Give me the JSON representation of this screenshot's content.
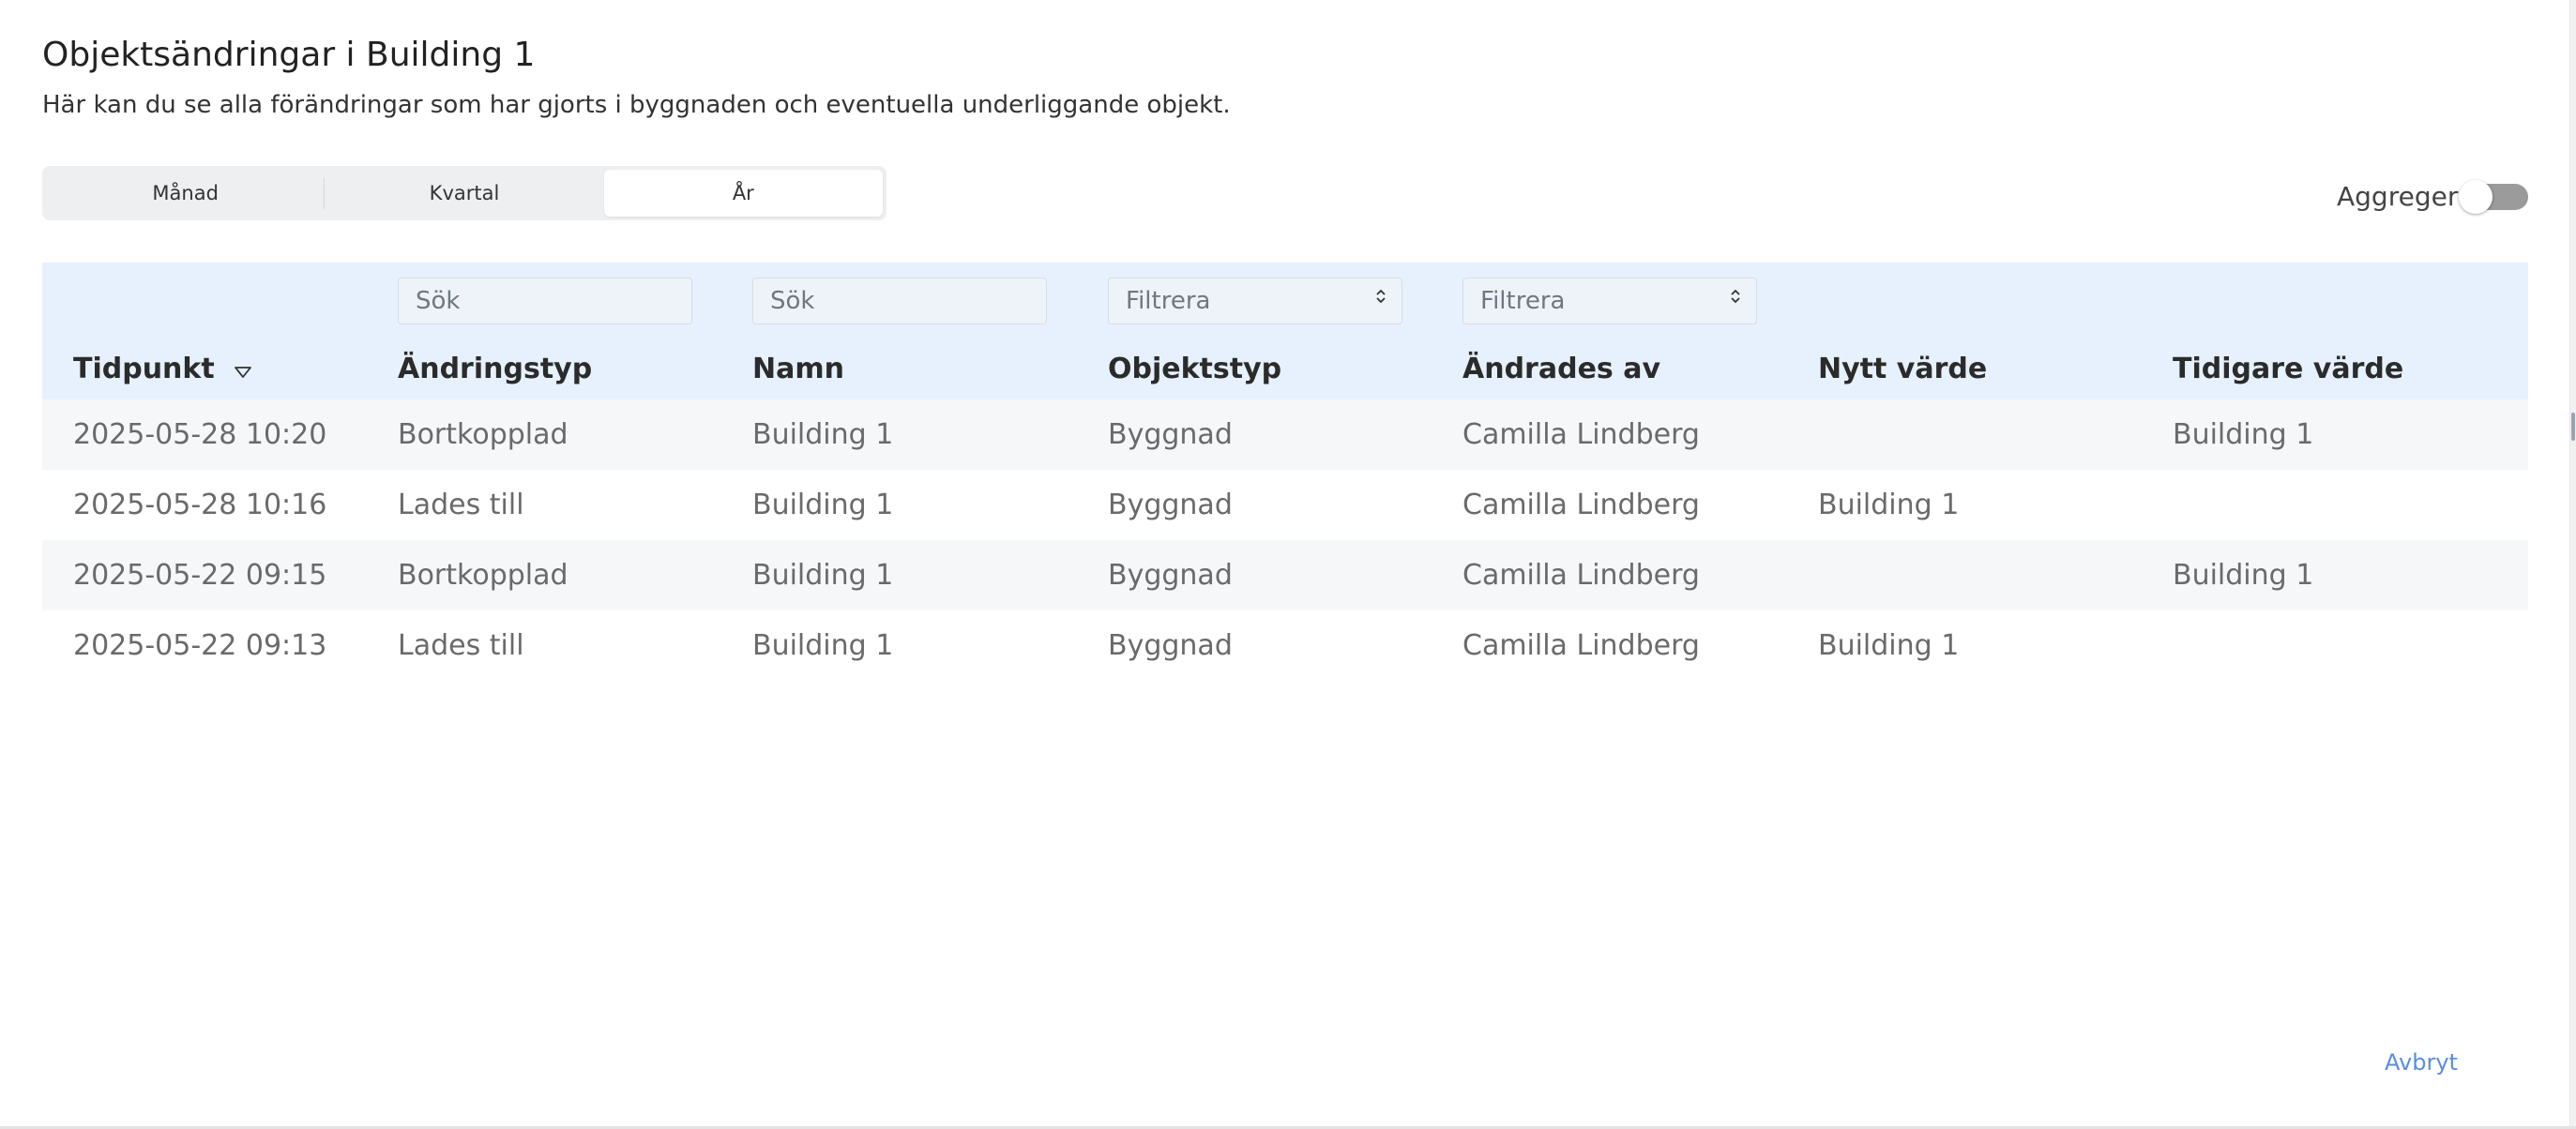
{
  "dialog": {
    "title": "Objektsändringar i Building 1",
    "subtitle": "Här kan du se alla förändringar som har gjorts i byggnaden och eventuella underliggande objekt."
  },
  "period_tabs": [
    {
      "label": "Månad",
      "active": false
    },
    {
      "label": "Kvartal",
      "active": false
    },
    {
      "label": "År",
      "active": true
    }
  ],
  "aggregate": {
    "label": "Aggregera",
    "enabled": false
  },
  "filters": {
    "change_type_placeholder": "Sök",
    "name_placeholder": "Sök",
    "object_type_placeholder": "Filtrera",
    "changed_by_placeholder": "Filtrera"
  },
  "columns": [
    "Tidpunkt",
    "Ändringstyp",
    "Namn",
    "Objektstyp",
    "Ändrades av",
    "Nytt värde",
    "Tidigare värde"
  ],
  "rows": [
    [
      "2025-05-28 10:20",
      "Bortkopplad",
      "Building 1",
      "Byggnad",
      "Camilla Lindberg",
      "",
      "Building 1"
    ],
    [
      "2025-05-28 10:16",
      "Lades till",
      "Building 1",
      "Byggnad",
      "Camilla Lindberg",
      "Building 1",
      ""
    ],
    [
      "2025-05-22 09:15",
      "Bortkopplad",
      "Building 1",
      "Byggnad",
      "Camilla Lindberg",
      "",
      "Building 1"
    ],
    [
      "2025-05-22 09:13",
      "Lades till",
      "Building 1",
      "Byggnad",
      "Camilla Lindberg",
      "Building 1",
      ""
    ]
  ],
  "actions": {
    "cancel_label": "Avbryt"
  },
  "colors": {
    "header_bg": "#e6f1fd",
    "accent": "#5b8de0",
    "row_alt": "#f6f7f8"
  }
}
